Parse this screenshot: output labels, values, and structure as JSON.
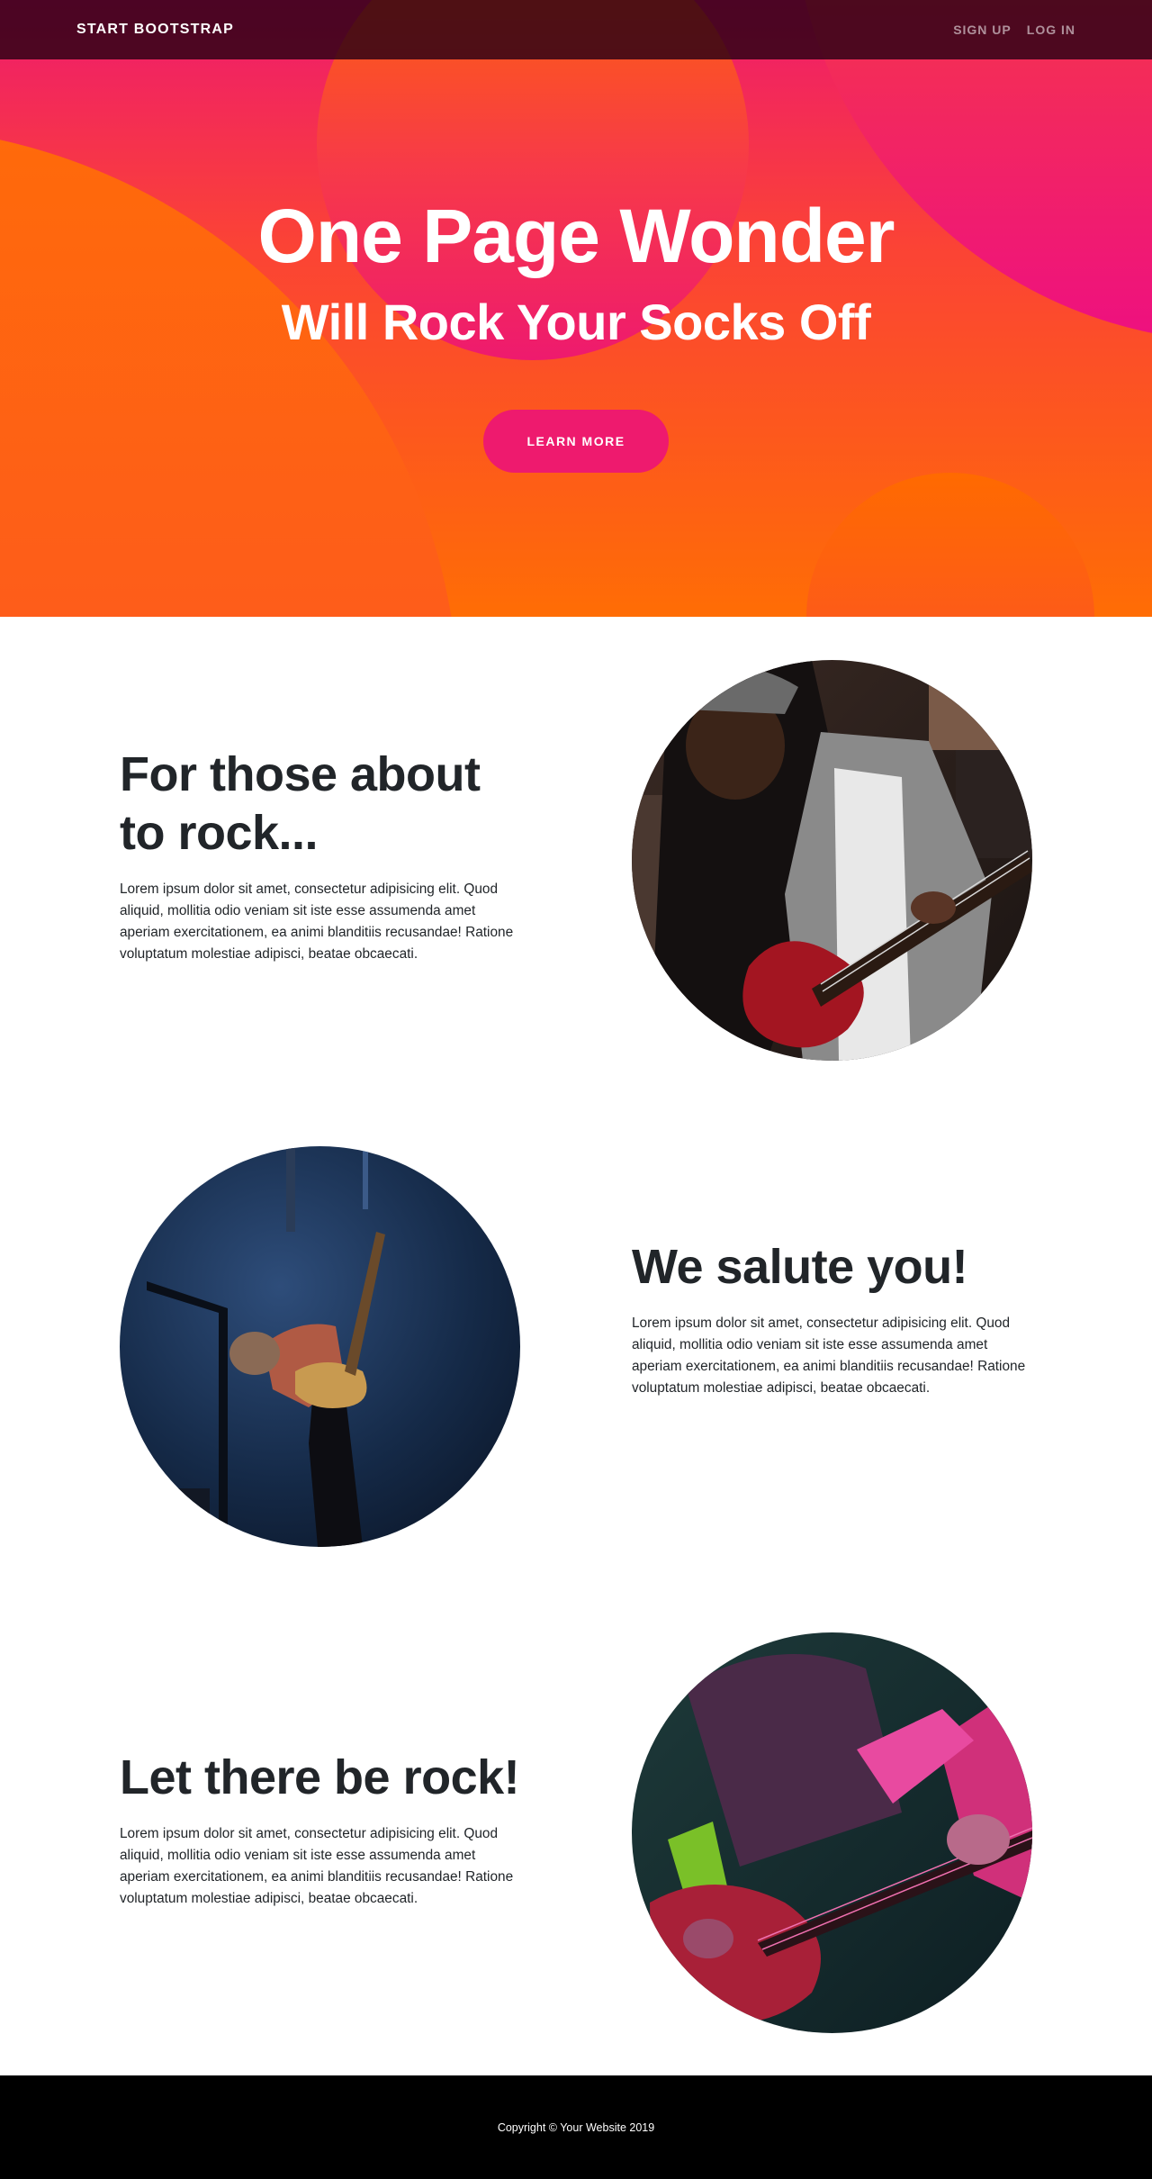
{
  "nav": {
    "brand": "Start Bootstrap",
    "links": [
      "Sign Up",
      "Log In"
    ]
  },
  "hero": {
    "title": "One Page Wonder",
    "subtitle": "Will Rock Your Socks Off",
    "button": "Learn More"
  },
  "sections": [
    {
      "title": "For those about to rock...",
      "body": "Lorem ipsum dolor sit amet, consectetur adipisicing elit. Quod aliquid, mollitia odio veniam sit iste esse assumenda amet aperiam exercitationem, ea animi blanditiis recusandae! Ratione voluptatum molestiae adipisci, beatae obcaecati.",
      "image": "woman-playing-red-guitar-photo"
    },
    {
      "title": "We salute you!",
      "body": "Lorem ipsum dolor sit amet, consectetur adipisicing elit. Quod aliquid, mollitia odio veniam sit iste esse assumenda amet aperiam exercitationem, ea animi blanditiis recusandae! Ratione voluptatum molestiae adipisci, beatae obcaecati.",
      "image": "guitarist-on-stage-photo"
    },
    {
      "title": "Let there be rock!",
      "body": "Lorem ipsum dolor sit amet, consectetur adipisicing elit. Quod aliquid, mollitia odio veniam sit iste esse assumenda amet aperiam exercitationem, ea animi blanditiis recusandae! Ratione voluptatum molestiae adipisci, beatae obcaecati.",
      "image": "guitar-closeup-neon-photo"
    }
  ],
  "footer": {
    "copyright": "Copyright © Your Website 2019"
  },
  "colors": {
    "accent": "#ee1a6e",
    "orange": "#ff6a00",
    "dark": "#212529"
  }
}
